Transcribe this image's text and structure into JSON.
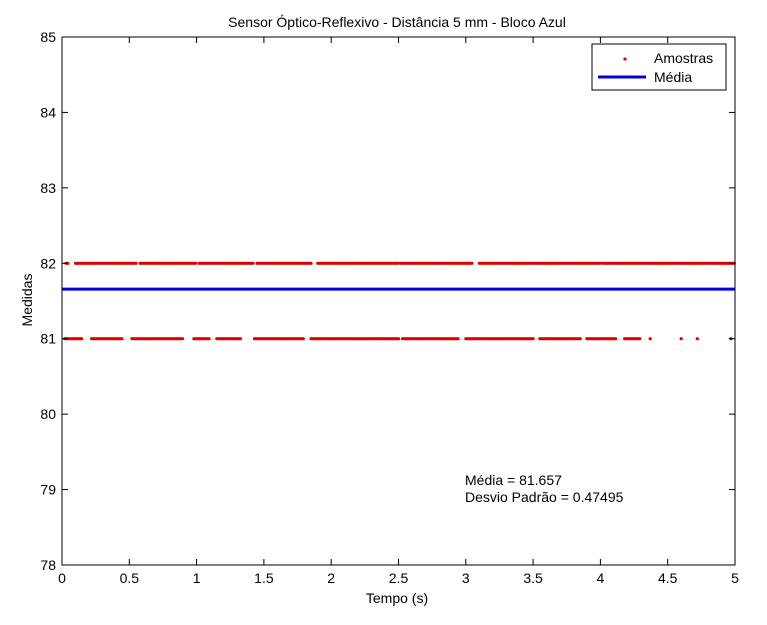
{
  "chart_data": {
    "type": "scatter",
    "title": "Sensor Óptico-Reflexivo - Distância 5 mm - Bloco Azul",
    "xlabel": "Tempo (s)",
    "ylabel": "Medidas",
    "xlim": [
      0,
      5
    ],
    "ylim": [
      78,
      85
    ],
    "xticks": [
      0,
      0.5,
      1,
      1.5,
      2,
      2.5,
      3,
      3.5,
      4,
      4.5,
      5
    ],
    "xtick_labels": [
      "0",
      "0.5",
      "1",
      "1.5",
      "2",
      "2.5",
      "3",
      "3.5",
      "4",
      "4.5",
      "5"
    ],
    "yticks": [
      78,
      79,
      80,
      81,
      82,
      83,
      84,
      85
    ],
    "ytick_labels": [
      "78",
      "79",
      "80",
      "81",
      "82",
      "83",
      "84",
      "85"
    ],
    "grid": false,
    "legend_position": "top-right",
    "series": [
      {
        "name": "Amostras",
        "kind": "points",
        "color": "#e00000",
        "levels": [
          {
            "y": 82,
            "x_ranges": [
              [
                0.03,
                0.05
              ],
              [
                0.1,
                0.55
              ],
              [
                0.58,
                1.0
              ],
              [
                1.02,
                1.42
              ],
              [
                1.45,
                1.85
              ],
              [
                1.9,
                2.5
              ],
              [
                2.52,
                3.05
              ],
              [
                3.1,
                4.0
              ],
              [
                4.02,
                5.0
              ]
            ]
          },
          {
            "y": 81,
            "x_ranges": [
              [
                0.02,
                0.15
              ],
              [
                0.22,
                0.45
              ],
              [
                0.52,
                0.9
              ],
              [
                0.98,
                1.1
              ],
              [
                1.15,
                1.33
              ],
              [
                1.43,
                1.8
              ],
              [
                1.85,
                2.5
              ],
              [
                2.53,
                2.95
              ],
              [
                3.0,
                3.5
              ],
              [
                3.55,
                3.85
              ],
              [
                3.9,
                4.12
              ],
              [
                4.18,
                4.3
              ],
              [
                4.37,
                4.38
              ],
              [
                4.6,
                4.61
              ],
              [
                4.72,
                4.73
              ],
              [
                4.97,
                4.98
              ]
            ]
          }
        ]
      },
      {
        "name": "Média",
        "kind": "line",
        "color": "#0000e0",
        "y": 81.657
      }
    ],
    "annotations": [
      "Média = 81.657",
      "Desvio Padrão = 0.47495"
    ]
  }
}
